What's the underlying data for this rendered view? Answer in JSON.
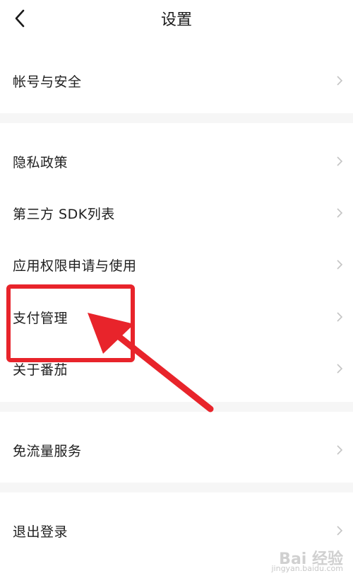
{
  "header": {
    "title": "设置"
  },
  "menu": [
    {
      "label": "帐号与安全"
    },
    {
      "label": "隐私政策"
    },
    {
      "label": "第三方 SDK列表"
    },
    {
      "label": "应用权限申请与使用"
    },
    {
      "label": "支付管理"
    },
    {
      "label": "关于番茄"
    },
    {
      "label": "免流量服务"
    },
    {
      "label": "退出登录"
    }
  ],
  "watermark": {
    "brand": "Bai 经验",
    "url": "jingyan.baidu.com"
  },
  "colors": {
    "annotation_red": "#e8242b",
    "chevron": "#c4c4c4",
    "separator": "#f6f6f6"
  }
}
